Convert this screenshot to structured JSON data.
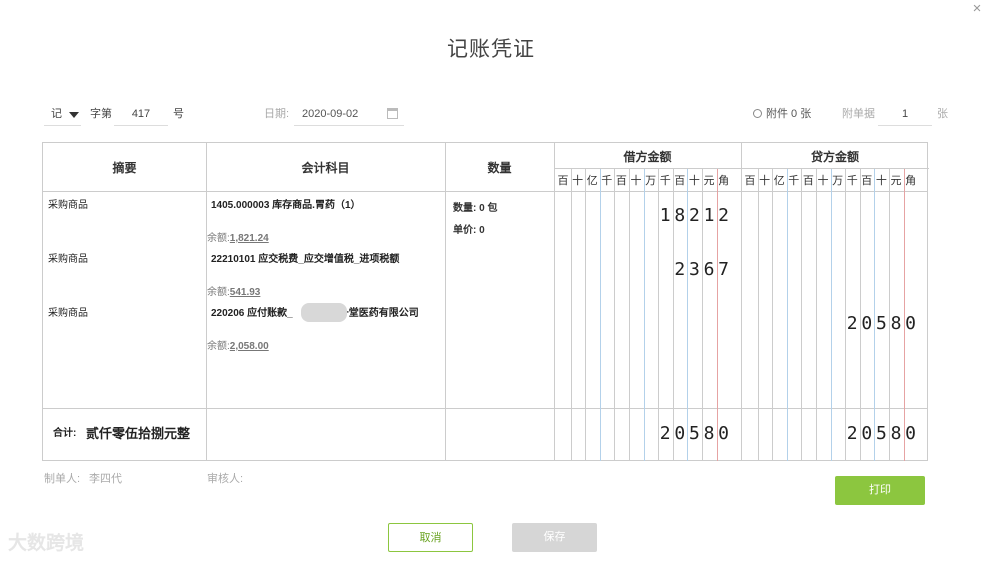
{
  "dialog": {
    "title": "记账凭证",
    "close_glyph": "×"
  },
  "header": {
    "word": "记",
    "zidi_label": "字第",
    "voucher_number": "417",
    "hao_label": "号",
    "date_label": "日期:",
    "date_value": "2020-09-02",
    "attachment_text": "附件 0 张",
    "fudanju_label": "附单据",
    "fudanju_value": "1",
    "zhang_label": "张"
  },
  "table": {
    "headers": {
      "summary": "摘要",
      "account": "会计科目",
      "quantity": "数量",
      "debit": "借方金额",
      "credit": "贷方金额"
    },
    "units": [
      "百",
      "十",
      "亿",
      "千",
      "百",
      "十",
      "万",
      "千",
      "百",
      "十",
      "元",
      "角"
    ],
    "rows": [
      {
        "summary": "采购商品",
        "account": "1405.000003 库存商品.胃药（1）",
        "balance_label": "余额:",
        "balance": "1,821.24",
        "debit": "18212",
        "credit": ""
      },
      {
        "summary": "采购商品",
        "account": "22210101 应交税费_应交增值税_进项税额",
        "balance_label": "余额:",
        "balance": "541.93",
        "debit": "2367",
        "credit": ""
      },
      {
        "summary": "采购商品",
        "account": "220206 应付账款_",
        "account_suffix": "一堂医药有限公司",
        "balance_label": "余额:",
        "balance": "2,058.00",
        "debit": "",
        "credit": "20580"
      }
    ],
    "quantity": {
      "qty_text": "数量: 0 包",
      "price_text": "单价: 0"
    },
    "total": {
      "label": "合计:",
      "words": "贰仟零伍拾捌元整",
      "debit": "20580",
      "credit": "20580"
    }
  },
  "footer": {
    "maker_label": "制单人:",
    "maker": "李四代",
    "reviewer_label": "审核人:",
    "print_label": "打印",
    "cancel_label": "取消",
    "save_label": "保存"
  },
  "watermark": "大数跨境",
  "colors": {
    "accent": "#8cc63f",
    "disabled": "#d6d6d6",
    "blue_line": "#b3d1ea",
    "red_line": "#e6a3a3"
  }
}
